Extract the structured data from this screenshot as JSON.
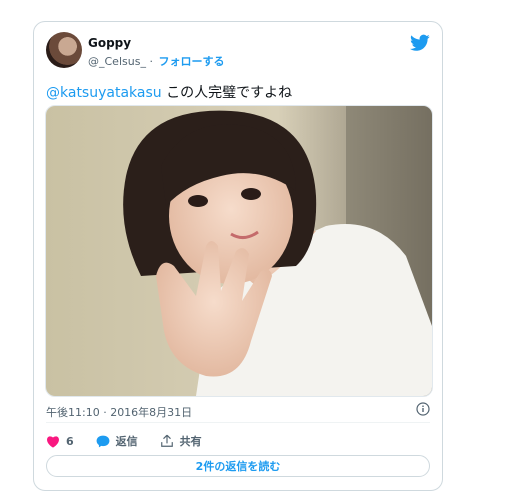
{
  "tweet": {
    "author": {
      "name": "Goppy",
      "handle": "@_Celsus_"
    },
    "separator": "·",
    "follow_label": "フォローする",
    "mention": "@katsuyatakasu",
    "text": "この人完璧ですよね",
    "timestamp": "午後11:10 · 2016年8月31日",
    "likes": "6",
    "reply_label": "返信",
    "share_label": "共有",
    "read_replies_label": "2件の返信を読む"
  },
  "icons": [
    "twitter-bird-icon",
    "info-icon",
    "heart-icon",
    "reply-bubble-icon",
    "share-icon"
  ],
  "colors": {
    "accent": "#1d9bf0",
    "like": "#f91880",
    "muted": "#536471",
    "border": "#cfd9de"
  }
}
